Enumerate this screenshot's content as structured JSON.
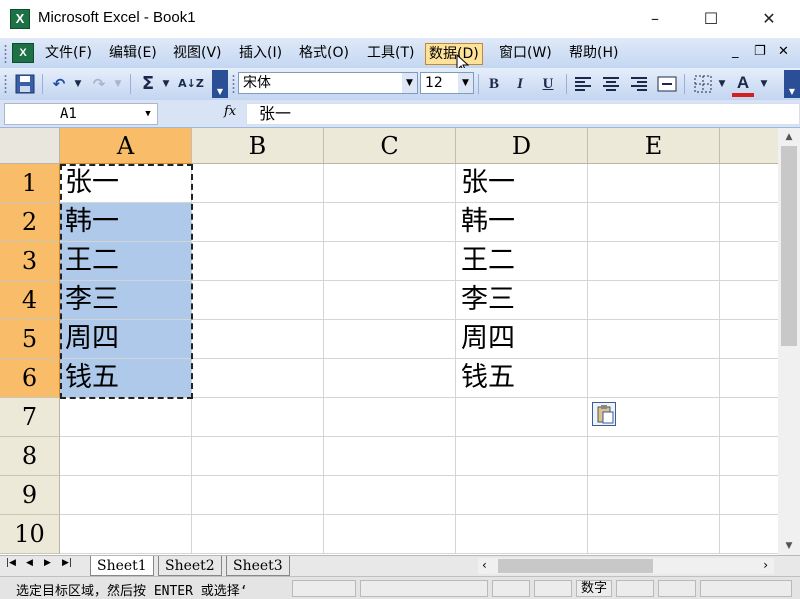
{
  "window": {
    "title": "Microsoft Excel - Book1",
    "minimize": "–",
    "maximize": "☐",
    "close": "✕"
  },
  "menu": {
    "items": [
      "文件(F)",
      "编辑(E)",
      "视图(V)",
      "插入(I)",
      "格式(O)",
      "工具(T)",
      "数据(D)",
      "窗口(W)",
      "帮助(H)"
    ],
    "active_item": "数据(D)",
    "doc_minimize": "_",
    "doc_restore": "❐",
    "doc_close": "✕"
  },
  "toolbar": {
    "font_name": "宋体",
    "font_size": "12",
    "bold": "B",
    "italic": "I",
    "underline": "U",
    "sum": "Σ",
    "sort": "A↓Z",
    "font_color_letter": "A",
    "accent_red": "#d41f1f"
  },
  "formula_bar": {
    "name_box": "A1",
    "fx_label": "fx",
    "formula": "张一"
  },
  "grid": {
    "columns": [
      "A",
      "B",
      "C",
      "D",
      "E"
    ],
    "rows": [
      "1",
      "2",
      "3",
      "4",
      "5",
      "6",
      "7",
      "8",
      "9",
      "10"
    ],
    "column_a": [
      "张一",
      "韩一",
      "王二",
      "李三",
      "周四",
      "钱五"
    ],
    "column_d": [
      "张一",
      "韩一",
      "王二",
      "李三",
      "周四",
      "钱五"
    ]
  },
  "sheets": {
    "tabs": [
      "Sheet1",
      "Sheet2",
      "Sheet3"
    ],
    "active": "Sheet1"
  },
  "status": {
    "message": "选定目标区域，然后按 ENTER 或选择‘",
    "indicator": "数字"
  },
  "colors": {
    "header_selected": "#f9bd6a",
    "selection_fill": "#aec9ea",
    "menubar": "#c4d7f2"
  }
}
